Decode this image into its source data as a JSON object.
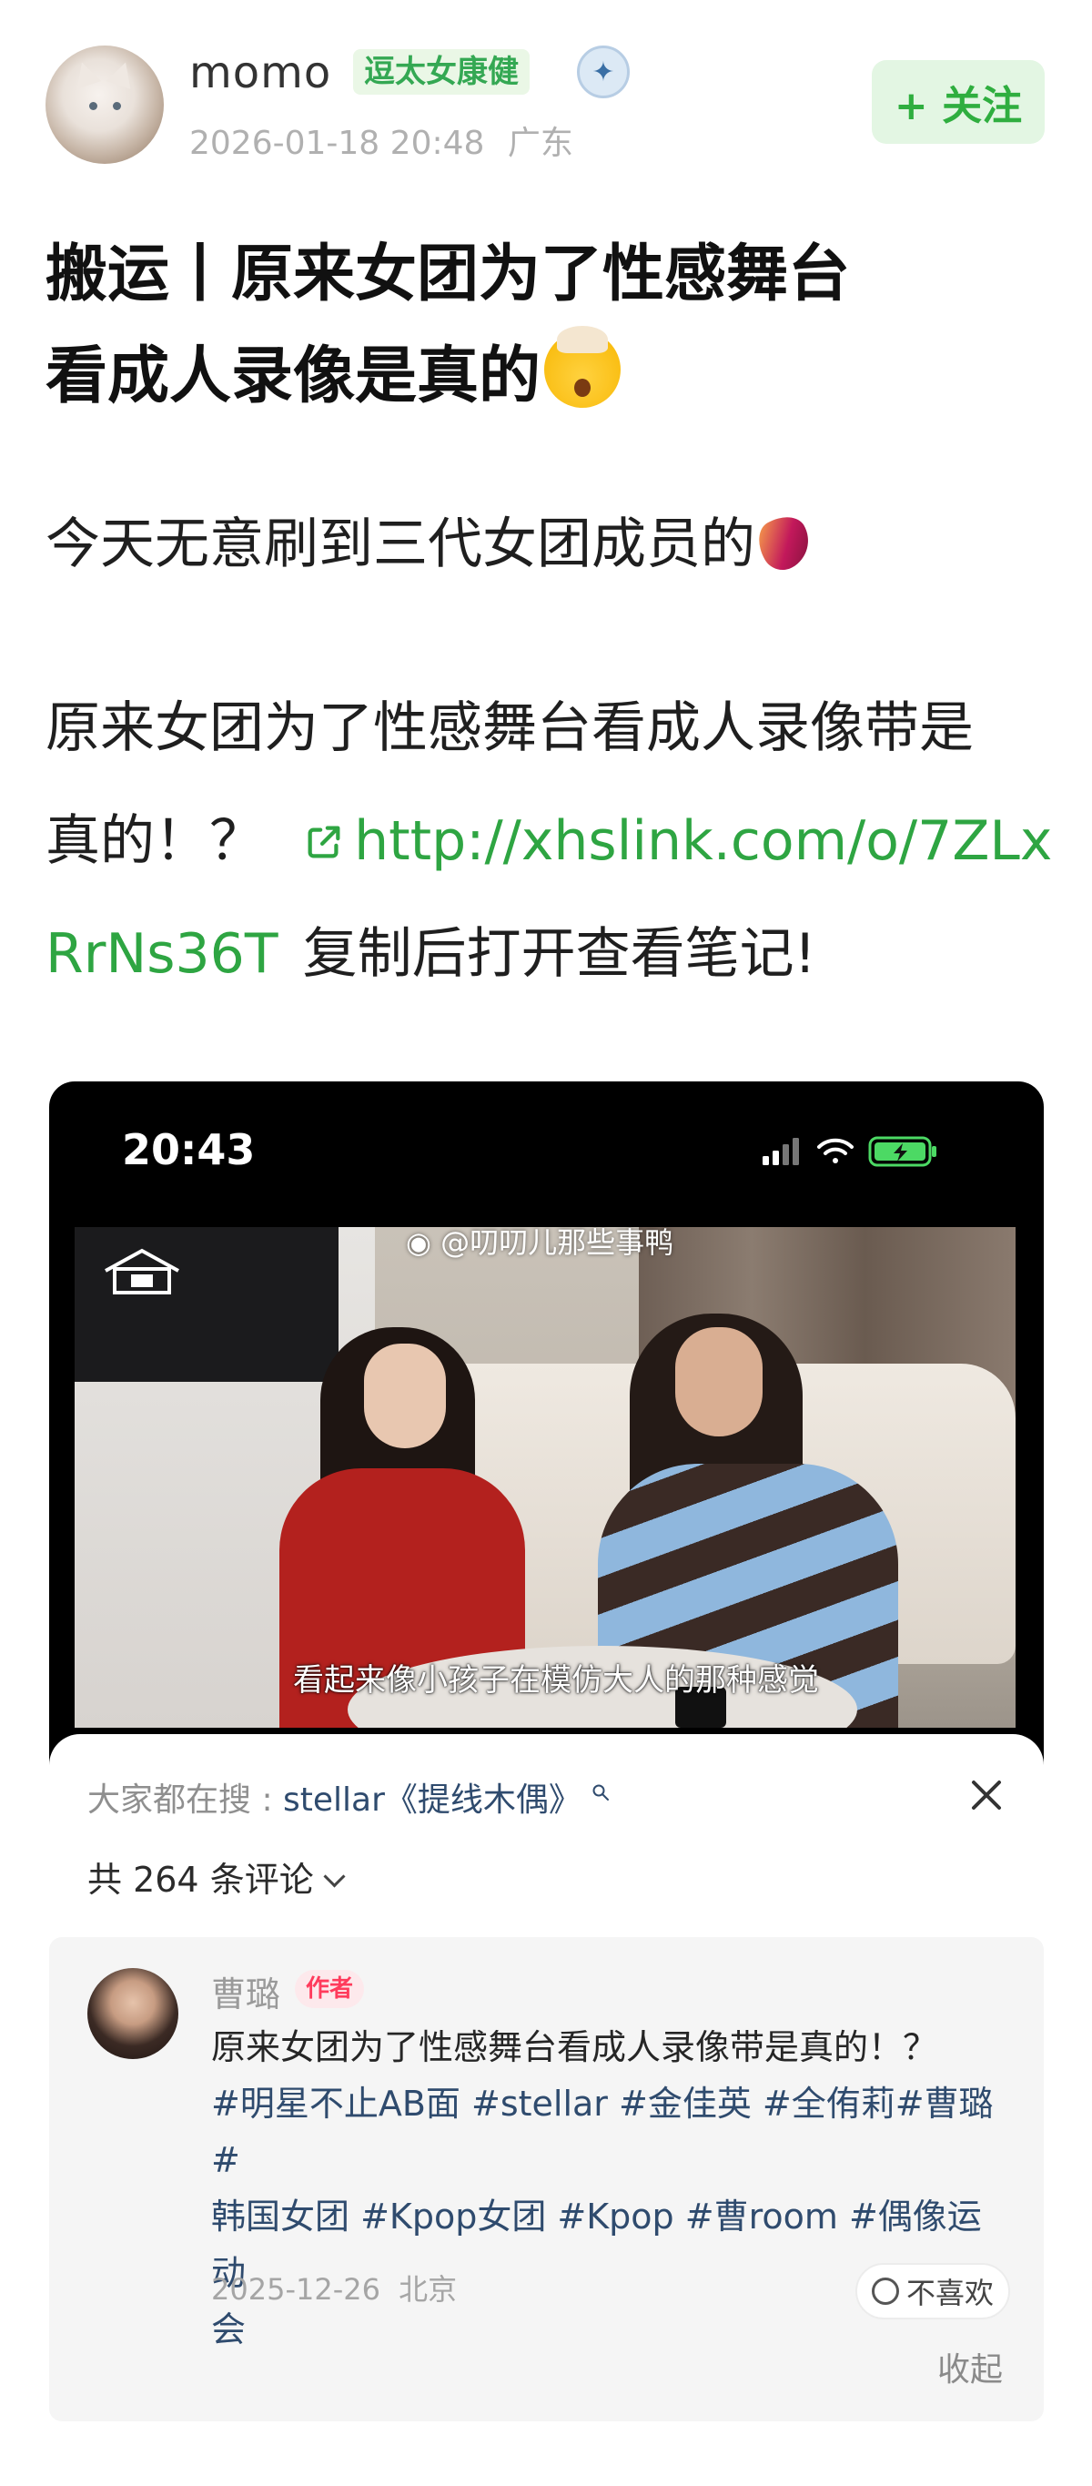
{
  "header": {
    "username": "momo",
    "user_tag": "逗太女康健",
    "timestamp": "2026-01-18 20:48",
    "location": "广东",
    "follow_label": "+ 关注"
  },
  "post": {
    "title_line1": "搬运丨原来女团为了性感舞台",
    "title_line2": "看成人录像是真的",
    "para1": "今天无意刷到三代女团成员的",
    "para2_line1": "原来女团为了性感舞台看成人录像带是",
    "para2_line2_text": "真的！？",
    "link_part1": "http://xhslink.com/o/7ZLx",
    "link_part2": "RrNs36T",
    "para2_tail": "复制后打开查看笔记!"
  },
  "video": {
    "status_time": "20:43",
    "watermark": "@叨叨儿那些事鸭",
    "subtitle": "看起来像小孩子在模仿大人的那种感觉"
  },
  "comments": {
    "search_prefix": "大家都在搜 :",
    "search_term": "stellar《提线木偶》",
    "count_label": "共 264 条评论",
    "item": {
      "name": "曹璐",
      "author_tag": "作者",
      "text_line1": "原来女团为了性感舞台看成人录像带是真的！？",
      "hashtags_line2": "#明星不止AB面 #stellar #金佳英 #全侑莉#曹璐 #",
      "hashtags_line3": "韩国女团 #Kpop女团 #Kpop #曹room #偶像运动",
      "hashtags_line4": "会",
      "date": "2025-12-26",
      "location": "北京",
      "dislike_label": "不喜欢"
    },
    "collapse_label": "收起"
  },
  "colors": {
    "accent_green": "#2ea542",
    "hashtag_blue": "#2f4b6e",
    "author_red": "#ff3b5c"
  }
}
